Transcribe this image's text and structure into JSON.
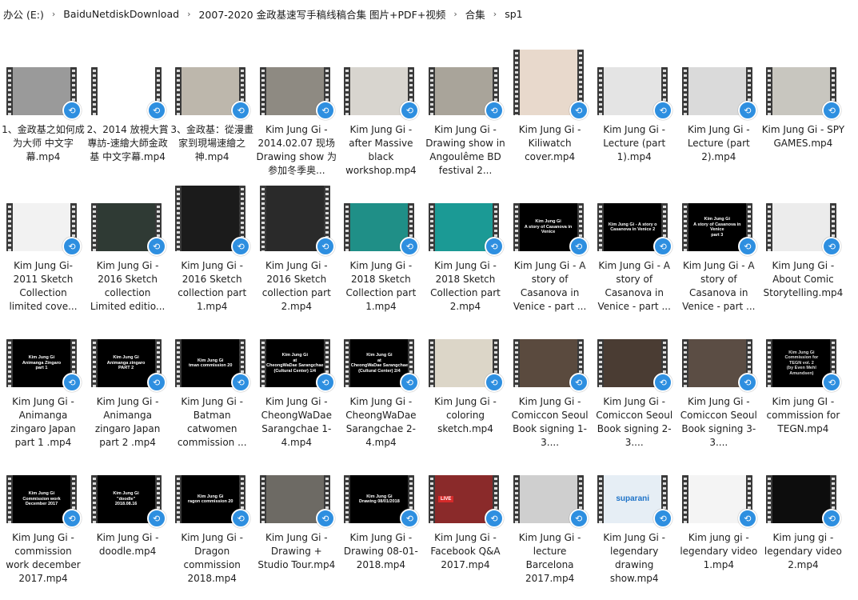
{
  "breadcrumb": [
    "办公 (E:)",
    "BaiduNetdiskDownload",
    "2007-2020 金政基速写手稿线稿合集 图片+PDF+视频",
    "合集",
    "sp1"
  ],
  "files": [
    {
      "name": "1、金政基之如何成为大师 中文字幕.mp4",
      "bg": "#9a9a9a",
      "thumb_text": "",
      "fg": "#ffffff",
      "tall": false
    },
    {
      "name": "2、2014 放視大賞專訪-速繪大師金政基 中文字幕.mp4",
      "bg": "#ffffff",
      "thumb_text": "",
      "fg": "#ffffff",
      "tall": false
    },
    {
      "name": "3、金政基：從漫畫家到現場速繪之神.mp4",
      "bg": "#bdb7ac",
      "thumb_text": "",
      "fg": "#ffffff",
      "tall": false
    },
    {
      "name": "Kim Jung Gi - 2014.02.07 现场 Drawing show 为参加冬季奥...",
      "bg": "#8e8a82",
      "thumb_text": "",
      "fg": "#ffffff",
      "tall": false
    },
    {
      "name": "Kim Jung Gi - after Massive black workshop.mp4",
      "bg": "#d8d5cf",
      "thumb_text": "",
      "fg": "#ffffff",
      "tall": false
    },
    {
      "name": "Kim Jung Gi - Drawing show in Angoulême BD festival 2...",
      "bg": "#a9a49a",
      "thumb_text": "",
      "fg": "#ffffff",
      "tall": false
    },
    {
      "name": "Kim Jung Gi - Kiliwatch cover.mp4",
      "bg": "#e8d9cc",
      "thumb_text": "",
      "fg": "#ffffff",
      "tall": true
    },
    {
      "name": "Kim Jung Gi - Lecture (part 1).mp4",
      "bg": "#e4e4e4",
      "thumb_text": "",
      "fg": "#ffffff",
      "tall": false
    },
    {
      "name": "Kim Jung Gi - Lecture (part 2).mp4",
      "bg": "#dadada",
      "thumb_text": "",
      "fg": "#ffffff",
      "tall": false
    },
    {
      "name": "Kim Jung Gi - SPY GAMES.mp4",
      "bg": "#c8c6bf",
      "thumb_text": "",
      "fg": "#ffffff",
      "tall": false
    },
    {
      "name": "Kim Jung Gi- 2011 Sketch Collection limited cove...",
      "bg": "#f2f2f2",
      "thumb_text": "",
      "fg": "#ffffff",
      "tall": false
    },
    {
      "name": "Kim Jung Gi - 2016 Sketch collection Limited editio...",
      "bg": "#2f3a34",
      "thumb_text": "",
      "fg": "#ffffff",
      "tall": false
    },
    {
      "name": "Kim Jung Gi - 2016 Sketch collection part 1.mp4",
      "bg": "#1b1b1b",
      "thumb_text": "",
      "fg": "#ffffff",
      "tall": true
    },
    {
      "name": "Kim Jung Gi - 2016 Sketch collection part 2.mp4",
      "bg": "#2a2a2a",
      "thumb_text": "",
      "fg": "#ffffff",
      "tall": true
    },
    {
      "name": "Kim Jung Gi - 2018 Sketch Collection part 1.mp4",
      "bg": "#1f8f87",
      "thumb_text": "",
      "fg": "#ffffff",
      "tall": false
    },
    {
      "name": "Kim Jung Gi - 2018 Sketch Collection part 2.mp4",
      "bg": "#1b9a95",
      "thumb_text": "",
      "fg": "#ffffff",
      "tall": false
    },
    {
      "name": "Kim Jung Gi - A story of Casanova in Venice - part ...",
      "bg": "#000000",
      "thumb_text": "Kim Jung Gi\nA story of Casanova in\nVenice",
      "fg": "#ffffff",
      "tall": false
    },
    {
      "name": "Kim Jung Gi - A story of Casanova in Venice - part ...",
      "bg": "#000000",
      "thumb_text": "Kim Jung Gi - A story o\nCasanova in Venice 2",
      "fg": "#ffffff",
      "tall": false
    },
    {
      "name": "Kim Jung Gi - A story of Casanova in Venice - part ...",
      "bg": "#000000",
      "thumb_text": "Kim Jung Gi\nA story of Casanova in Venice\npart 3",
      "fg": "#ffffff",
      "tall": false
    },
    {
      "name": "Kim Jung Gi - About Comic Storytelling.mp4",
      "bg": "#ececec",
      "thumb_text": "",
      "fg": "#ffffff",
      "tall": false
    },
    {
      "name": "Kim Jung Gi - Animanga zingaro Japan part 1 .mp4",
      "bg": "#000000",
      "thumb_text": "Kim Jung Gi\nAnimanga Zingaro\npart 1",
      "fg": "#ffffff",
      "tall": false
    },
    {
      "name": "Kim Jung Gi - Animanga zingaro Japan part 2 .mp4",
      "bg": "#000000",
      "thumb_text": "Kim Jung Gi\nAnimanga zingaro\nPART 2",
      "fg": "#ffffff",
      "tall": false
    },
    {
      "name": "Kim Jung Gi - Batman catwomen commission ...",
      "bg": "#000000",
      "thumb_text": "Kim Jung Gi\ntman commission 20",
      "fg": "#ffffff",
      "tall": false
    },
    {
      "name": "Kim Jung Gi - CheongWaDae Sarangchae 1-4.mp4",
      "bg": "#000000",
      "thumb_text": "Kim Jung Gi\nat\nCheongWaDae Sarangchae\n(Cultural Center) 1/4",
      "fg": "#ffffff",
      "tall": false
    },
    {
      "name": "Kim Jung Gi - CheongWaDae Sarangchae 2-4.mp4",
      "bg": "#000000",
      "thumb_text": "Kim Jung Gi\nat\nCheongWaDae Sarangchae\n(Cultural Center) 2/4",
      "fg": "#ffffff",
      "tall": false
    },
    {
      "name": "Kim Jung Gi - coloring sketch.mp4",
      "bg": "#dcd6c8",
      "thumb_text": "",
      "fg": "#ffffff",
      "tall": false
    },
    {
      "name": "Kim Jung Gi - Comiccon Seoul Book signing 1-3....",
      "bg": "#5a4a3e",
      "thumb_text": "",
      "fg": "#ffffff",
      "tall": false
    },
    {
      "name": "Kim Jung Gi - Comiccon Seoul Book signing 2-3....",
      "bg": "#4a3c33",
      "thumb_text": "",
      "fg": "#ffffff",
      "tall": false
    },
    {
      "name": "Kim Jung Gi - Comiccon Seoul Book signing 3-3....",
      "bg": "#5b4d44",
      "thumb_text": "",
      "fg": "#ffffff",
      "tall": false
    },
    {
      "name": "Kim jung GI - commission for TEGN.mp4",
      "bg": "#000000",
      "thumb_text": "Kim Jung Gi\nCommission for\nTEGN vol. 2\n(by Even Mehl\nAmundsen)",
      "fg": "#dddddd",
      "tall": false
    },
    {
      "name": "Kim Jung Gi - commission work december 2017.mp4",
      "bg": "#000000",
      "thumb_text": "Kim Jung Gi\nCommission work\nDecember 2017",
      "fg": "#ffffff",
      "tall": false
    },
    {
      "name": "Kim Jung Gi - doodle.mp4",
      "bg": "#000000",
      "thumb_text": "Kim Jung Gi\n\"doodle\"\n2018.08.16",
      "fg": "#ffffff",
      "tall": false
    },
    {
      "name": "Kim Jung Gi - Dragon commission 2018.mp4",
      "bg": "#000000",
      "thumb_text": "Kim Jung Gi\nragon commission 20",
      "fg": "#ffffff",
      "tall": false
    },
    {
      "name": "Kim Jung Gi - Drawing + Studio Tour.mp4",
      "bg": "#6d6a64",
      "thumb_text": "",
      "fg": "#ffffff",
      "tall": false
    },
    {
      "name": "Kim Jung Gi - Drawing 08-01-2018.mp4",
      "bg": "#000000",
      "thumb_text": "Kim Jung Gi\nDrawing 08/01/2018",
      "fg": "#ffffff",
      "tall": false
    },
    {
      "name": "Kim Jung Gi - Facebook Q&A 2017.mp4",
      "bg": "#8a2a2a",
      "thumb_text": "LIVE",
      "fg": "#ffffff",
      "tall": false
    },
    {
      "name": "Kim Jung Gi - lecture Barcelona 2017.mp4",
      "bg": "#cfcfcf",
      "thumb_text": "",
      "fg": "#ffffff",
      "tall": false
    },
    {
      "name": "Kim Jung Gi - legendary drawing show.mp4",
      "bg": "#e6eef5",
      "thumb_text": "suparani",
      "fg": "#1e73c8",
      "tall": false
    },
    {
      "name": "Kim jung gi - legendary video 1.mp4",
      "bg": "#f4f4f4",
      "thumb_text": "",
      "fg": "#ffffff",
      "tall": false
    },
    {
      "name": "Kim jung gi - legendary video 2.mp4",
      "bg": "#0d0d0d",
      "thumb_text": "",
      "fg": "#ffffff",
      "tall": false
    }
  ]
}
